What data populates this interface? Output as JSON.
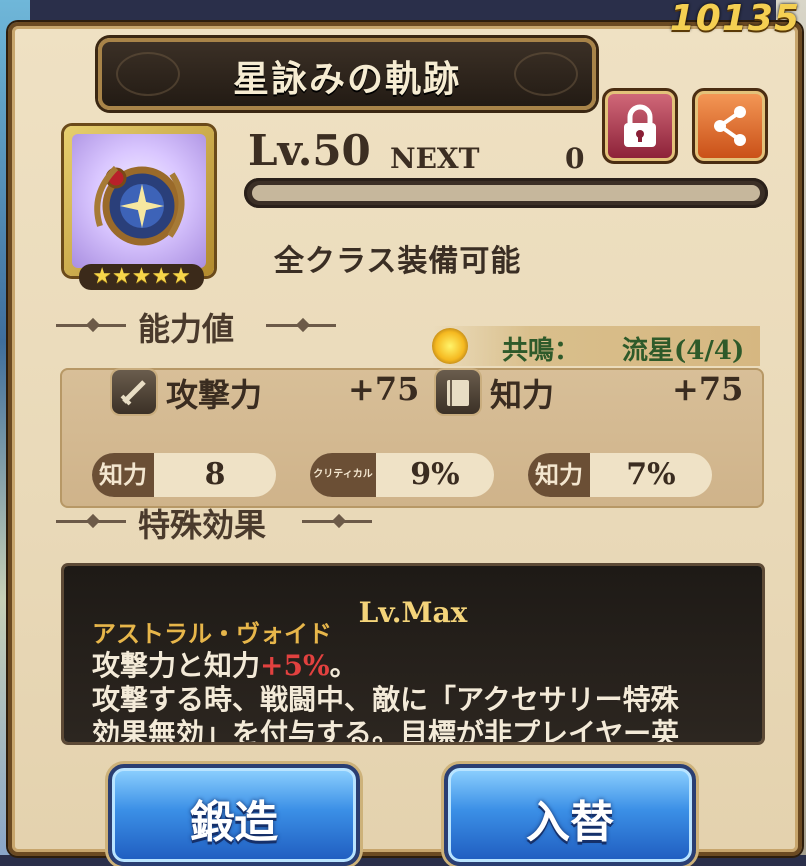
{
  "header": {
    "currency_value": "10135",
    "title": "星詠みの軌跡"
  },
  "actions": {
    "lock_icon": "lock-icon",
    "share_icon": "share-icon"
  },
  "item": {
    "level": "Lv.50",
    "next_label": "NEXT",
    "next_value": "0",
    "exp_progress": 1.0,
    "rarity_stars": 5,
    "stars_text": "★★★★★",
    "equip_class": "全クラス装備可能"
  },
  "stats": {
    "heading": "能力値",
    "resonance_label": "共鳴：",
    "resonance_value": "流星(4/4)",
    "attack": {
      "name": "攻撃力",
      "value": "+75"
    },
    "intelligence": {
      "name": "知力",
      "value": "+75"
    },
    "sub": [
      {
        "tag": "知力",
        "value": "8"
      },
      {
        "tag": "クリティカル",
        "value": "9%"
      },
      {
        "tag": "知力",
        "value": "7%"
      }
    ]
  },
  "effect": {
    "heading": "特殊効果",
    "level": "Lv.Max",
    "name": "アストラル・ヴォイド",
    "line1_prefix": "攻撃力と知力",
    "line1_highlight": "+5%",
    "line1_suffix": "。",
    "line2": "攻撃する時、戦闘中、敵に「アクセサリー特殊",
    "line3": "効果無効」を付与する。目標が非プレイヤー英"
  },
  "buttons": {
    "forge": "鍛造",
    "swap": "入替"
  },
  "colors": {
    "accent_gold": "#f4cf52",
    "button_blue": "#3b8fe6",
    "highlight_red": "#e2413f"
  }
}
